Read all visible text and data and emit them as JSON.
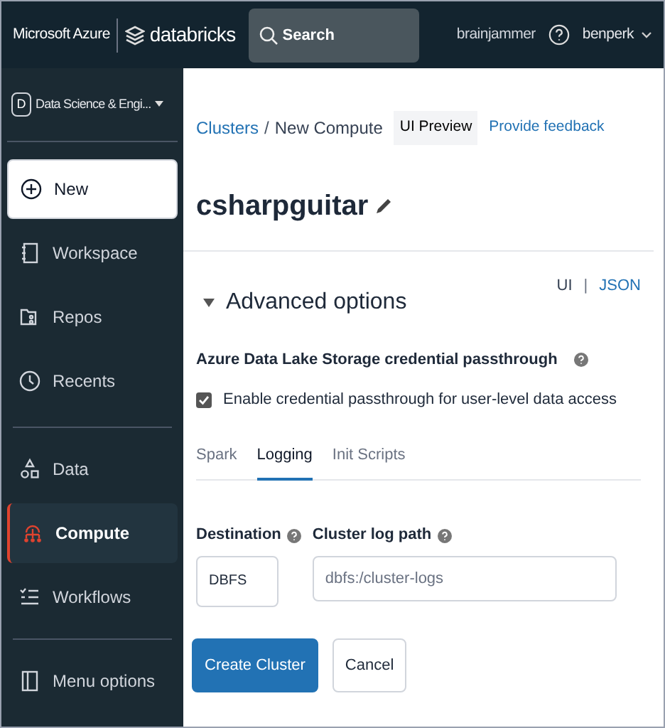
{
  "topbar": {
    "brand": "Microsoft Azure",
    "product": "databricks",
    "search": {
      "placeholder": "Search"
    },
    "workspace_name": "brainjammer",
    "user": "benperk"
  },
  "sidebar": {
    "persona": {
      "letter": "D",
      "label": "Data Science & Engi..."
    },
    "items": [
      {
        "kind": "new",
        "label": "New",
        "selected": false
      },
      {
        "kind": "workspace",
        "label": "Workspace",
        "selected": false
      },
      {
        "kind": "repos",
        "label": "Repos",
        "selected": false
      },
      {
        "kind": "recents",
        "label": "Recents",
        "selected": false
      },
      {
        "kind": "divider"
      },
      {
        "kind": "data",
        "label": "Data",
        "selected": false
      },
      {
        "kind": "compute",
        "label": "Compute",
        "selected": true
      },
      {
        "kind": "workflows",
        "label": "Workflows",
        "selected": false
      },
      {
        "kind": "spacer"
      },
      {
        "kind": "menu",
        "label": "Menu options",
        "selected": false
      }
    ]
  },
  "breadcrumb": {
    "parent": "Clusters",
    "separator": "/",
    "current": "New Compute",
    "badge": "UI Preview",
    "feedback": "Provide feedback"
  },
  "cluster_name": "csharpguitar",
  "view_toggle": {
    "ui": "UI",
    "separator": "|",
    "json": "JSON"
  },
  "advanced": {
    "title": "Advanced options",
    "expanded": true,
    "passthrough": {
      "heading": "Azure Data Lake Storage credential passthrough",
      "checkbox_label": "Enable credential passthrough for user-level data access",
      "checked": true
    },
    "tabs": [
      {
        "label": "Spark",
        "selected": false
      },
      {
        "label": "Logging",
        "selected": true
      },
      {
        "label": "Init Scripts",
        "selected": false
      }
    ],
    "destination": {
      "label": "Destination",
      "value": "DBFS"
    },
    "log_path": {
      "label": "Cluster log path",
      "placeholder": "dbfs:/cluster-logs"
    }
  },
  "buttons": [
    {
      "kind": "primary",
      "label": "Create Cluster"
    },
    {
      "kind": "secondary",
      "label": "Cancel"
    }
  ]
}
